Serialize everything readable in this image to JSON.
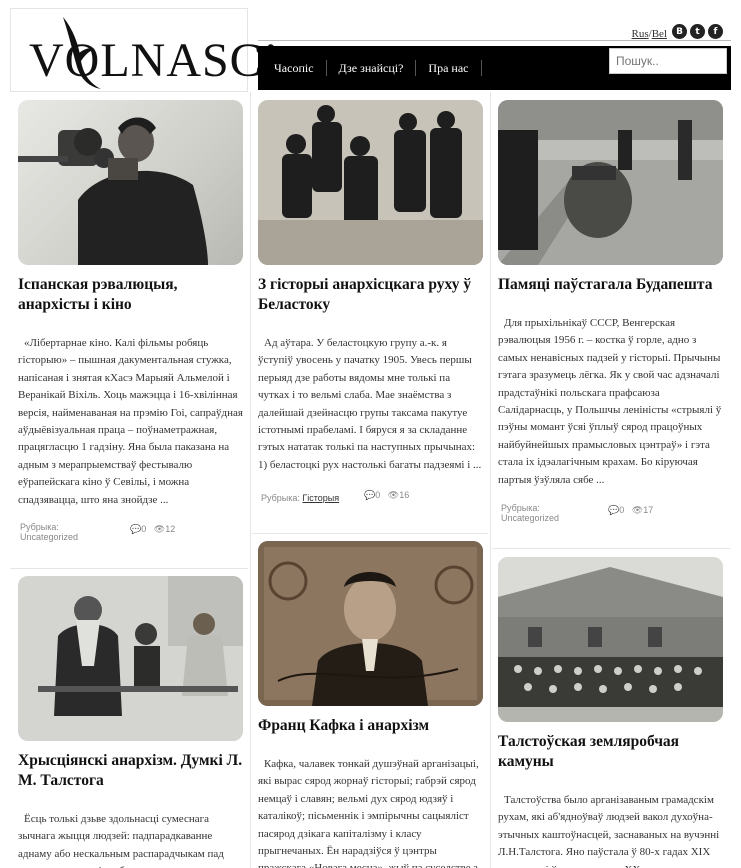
{
  "header": {
    "logo_text": "VOLNASC’",
    "lang_ru": "Rus",
    "lang_sep": "/",
    "lang_bel": "Bel",
    "social": [
      "B",
      "t",
      "f"
    ],
    "nav": [
      "Часопіс",
      "Дзе знайсці?",
      "Пра нас"
    ],
    "search_placeholder": "Пошук.."
  },
  "posts": [
    {
      "title": "Іспанская рэвалюцыя, анархісты і кіно",
      "excerpt": "«Лібертарнае кіно. Калі фільмы робяць гісторыю» – пышная дакументальная стужка, напісаная і знятая кХасэ Марыяй Альмелой і Веранікай Віхіль. Хоць мажэцца і 16-хвілінная версія, найменаваная на прэмію Гоі, сапраўдная аўдыёвізуальная праца – поўнаметражная, працягласцю 1 гадзіну. Яна была паказана на адным з мерапрыемстваў фестывалю еўрапейскага кіно ў Севільі, і можна спадзявацца, што яна знойдзе ...",
      "rubric_label": "Рубрыка:",
      "rubric": "Uncategorized",
      "comments": "0",
      "views": "12"
    },
    {
      "title": "З гісторыі анархісцкага руху ў Беластоку",
      "excerpt": "Ад аўтара. У беластоцкую групу а.-к. я ўступіў увосень у пачатку 1905. Увесь першы перыяд дзе работы вядомы мне толькі па чутках і то вельмі слаба. Мае знаёмства з далейшай дзейнасцю групы таксама пакутуе істотнымі прабеламі. І бяруся я за складанне гэтых нататак толькі па наступных прычынах: 1) беластоцкі рух настолькі багаты падзеямі і ...",
      "rubric_label": "Рубрыка:",
      "rubric": "Гісторыя",
      "comments": "0",
      "views": "16"
    },
    {
      "title": "Памяці паўстагала Будапешта",
      "excerpt": "Для прыхільнікаў СССР, Венгерская рэвалюцыя 1956 г. – костка ў горле, адно з самых ненавісных падзей у гісторыі. Прычыны гэтага зразумець лёгка. Як у свой час адзначалі прадстаўнікі польскага прафсаюза Салідарнасць, у Польшчы леніністы «стрыялі ў пэўны момант ўсяі ўплыў сярод працоўных найбуйнейшых прамысловых цэнтраў» і гэта стала іх ідэалагічным крахам. Бо кіруючая партыя ўзўляла сябе ...",
      "rubric_label": "Рубрыка:",
      "rubric": "Uncategorized",
      "comments": "0",
      "views": "17"
    },
    {
      "title": "Хрысціянскі анархізм. Думкі Л. М. Талстога",
      "excerpt": "Ёсць толькі дзьве здольнасці сумеснага зычнага жыцця людзей: падпарадкаванне аднаму або нескальным распарадчыкам пад страхам гвалту, ці свабоднае пагадненне",
      "rubric_label": "",
      "rubric": "",
      "comments": "",
      "views": ""
    },
    {
      "title": "Франц Кафка і анархізм",
      "excerpt": "Кафка, чалавек тонкай душэўнай арганізацыі, які вырас сярод жорнаў гісторыі; габрэй сярод немцаў і славян; вельмі дух сярод юдзяў і каталікоў; пісьменнік і эмпірычны сацыяліст пасярод дзікага капіталізму і класу прыгнечаных. Ён нарадзіўся ў цэнтры пражскага «Новага месца», жыў па суседстве з касцёлам і з",
      "rubric_label": "",
      "rubric": "",
      "comments": "",
      "views": ""
    },
    {
      "title": "Талстоўская земляробчая камуны",
      "excerpt": "Талстоўства было арганізаваным грамадскім рухам, які аб'ядноўваў людзей вакол духоўна-этычных каштоўнасцей, заснаваных на вучэнні Л.Н.Талстога. Яно паўстала ў 80-х гадах XIX стагоддзя і ўжо да пачатку XX стагоддзя распаўсюдзілася ў Цэнтральнай",
      "rubric_label": "",
      "rubric": "",
      "comments": "",
      "views": ""
    }
  ]
}
